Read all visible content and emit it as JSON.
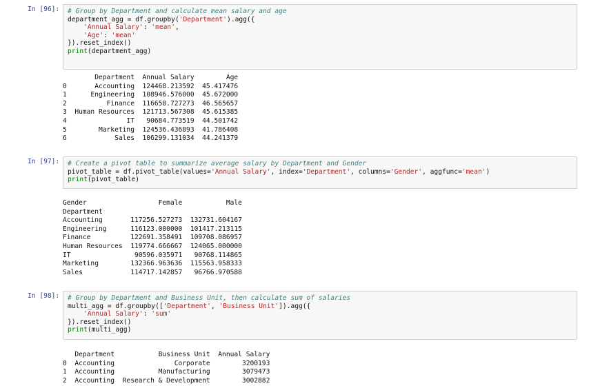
{
  "cells": [
    {
      "prompt": "In [96]:",
      "code": [
        [
          {
            "t": "# Group by Department and calculate mean salary and age",
            "c": "cm"
          }
        ],
        [
          {
            "t": "department_agg = df.groupby(",
            "c": ""
          },
          {
            "t": "'Department'",
            "c": "st"
          },
          {
            "t": ").agg({",
            "c": ""
          }
        ],
        [
          {
            "t": "    ",
            "c": ""
          },
          {
            "t": "'Annual Salary'",
            "c": "st"
          },
          {
            "t": ": ",
            "c": ""
          },
          {
            "t": "'mean'",
            "c": "st"
          },
          {
            "t": ",",
            "c": ""
          }
        ],
        [
          {
            "t": "    ",
            "c": ""
          },
          {
            "t": "'Age'",
            "c": "st"
          },
          {
            "t": ": ",
            "c": ""
          },
          {
            "t": "'mean'",
            "c": "st"
          }
        ],
        [
          {
            "t": "}).reset_index()",
            "c": ""
          }
        ],
        [
          {
            "t": "print",
            "c": "bi"
          },
          {
            "t": "(department_agg)",
            "c": ""
          }
        ]
      ],
      "output": [
        "        Department  Annual Salary        Age",
        "0       Accounting  124468.213592  45.417476",
        "1      Engineering  108946.576000  45.672000",
        "2          Finance  116658.727273  46.565657",
        "3  Human Resources  121713.567308  45.615385",
        "4               IT   90684.773519  44.501742",
        "5        Marketing  124536.436893  41.786408",
        "6            Sales  106299.131034  44.241379"
      ]
    },
    {
      "prompt": "In [97]:",
      "code": [
        [
          {
            "t": "# Create a pivot table to summarize average salary by Department and Gender",
            "c": "cm"
          }
        ],
        [
          {
            "t": "pivot_table = df.pivot_table(values=",
            "c": ""
          },
          {
            "t": "'Annual Salary'",
            "c": "st"
          },
          {
            "t": ", index=",
            "c": ""
          },
          {
            "t": "'Department'",
            "c": "st"
          },
          {
            "t": ", columns=",
            "c": ""
          },
          {
            "t": "'Gender'",
            "c": "st"
          },
          {
            "t": ", aggfunc=",
            "c": ""
          },
          {
            "t": "'mean'",
            "c": "st"
          },
          {
            "t": ")",
            "c": ""
          }
        ],
        [
          {
            "t": "print",
            "c": "bi"
          },
          {
            "t": "(pivot_table)",
            "c": ""
          }
        ]
      ],
      "output": [
        "Gender                  Female           Male",
        "Department",
        "Accounting       117256.527273  132731.604167",
        "Engineering      116123.000000  101417.213115",
        "Finance          122691.358491  109708.086957",
        "Human Resources  119774.666667  124065.000000",
        "IT                90596.035971   90768.114865",
        "Marketing        132366.963636  115563.958333",
        "Sales            114717.142857   96766.970588"
      ]
    },
    {
      "prompt": "In [98]:",
      "code": [
        [
          {
            "t": "# Group by Department and Business Unit, then calculate sum of salaries",
            "c": "cm"
          }
        ],
        [
          {
            "t": "multi_agg = df.groupby([",
            "c": ""
          },
          {
            "t": "'Department'",
            "c": "st"
          },
          {
            "t": ", ",
            "c": ""
          },
          {
            "t": "'Business Unit'",
            "c": "st"
          },
          {
            "t": "]).agg({",
            "c": ""
          }
        ],
        [
          {
            "t": "    ",
            "c": ""
          },
          {
            "t": "'Annual Salary'",
            "c": "st"
          },
          {
            "t": ": ",
            "c": ""
          },
          {
            "t": "'sum'",
            "c": "st"
          }
        ],
        [
          {
            "t": "}).reset_index()",
            "c": ""
          }
        ],
        [
          {
            "t": "print",
            "c": "bi"
          },
          {
            "t": "(multi_agg)",
            "c": ""
          }
        ]
      ],
      "output": [
        "   Department           Business Unit  Annual Salary",
        "0  Accounting               Corporate        3200193",
        "1  Accounting           Manufacturing        3079473",
        "2  Accounting  Research & Development        3002882"
      ]
    }
  ]
}
